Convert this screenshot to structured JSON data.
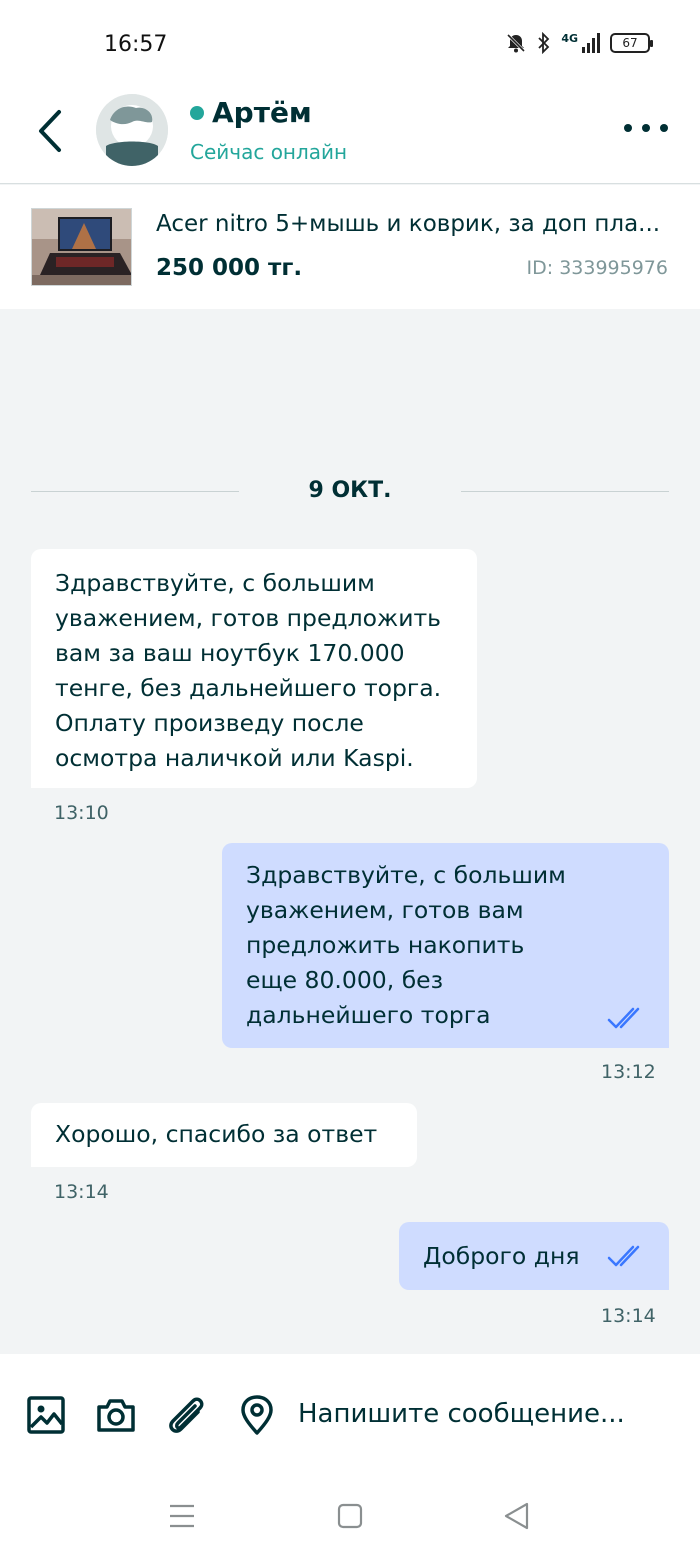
{
  "status_bar": {
    "time": "16:57",
    "battery": "67",
    "network": "4G"
  },
  "header": {
    "name": "Артём",
    "status": "Сейчас онлайн"
  },
  "ad": {
    "title": "Acer nitro 5+мышь и коврик, за доп пла...",
    "price": "250 000 тг.",
    "id": "ID: 333995976"
  },
  "chat": {
    "date": "9 ОКТ.",
    "messages": [
      {
        "direction": "incoming",
        "text": "Здравствуйте, с большим\nуважением, готов предложить\nвам за ваш ноутбук 170.000\nтенге, без дальнейшего торга.\nОплату произведу после\nосмотра наличкой или Kaspi.",
        "time": "13:10"
      },
      {
        "direction": "outgoing",
        "text": "Здравствуйте, с большим\nуважением, готов вам\nпредложить накопить\nеще 80.000, без\nдальнейшего торга",
        "time": "13:12",
        "read": true
      },
      {
        "direction": "incoming",
        "text": "Хорошо, спасибо за ответ",
        "time": "13:14"
      },
      {
        "direction": "outgoing",
        "text": "Доброго дня",
        "time": "13:14",
        "read": true
      }
    ]
  },
  "composer": {
    "placeholder": "Напишите сообщение..."
  },
  "colors": {
    "accent": "#23a69b",
    "text": "#002f34",
    "outgoing_bubble": "#cfdcff",
    "incoming_bubble": "#ffffff",
    "background": "#f2f4f5",
    "read_ticks": "#3a77ff"
  },
  "icons": [
    "back-arrow-icon",
    "more-icon",
    "gallery-icon",
    "camera-icon",
    "attach-icon",
    "location-icon",
    "menu-nav-icon",
    "home-nav-icon",
    "back-nav-icon"
  ]
}
